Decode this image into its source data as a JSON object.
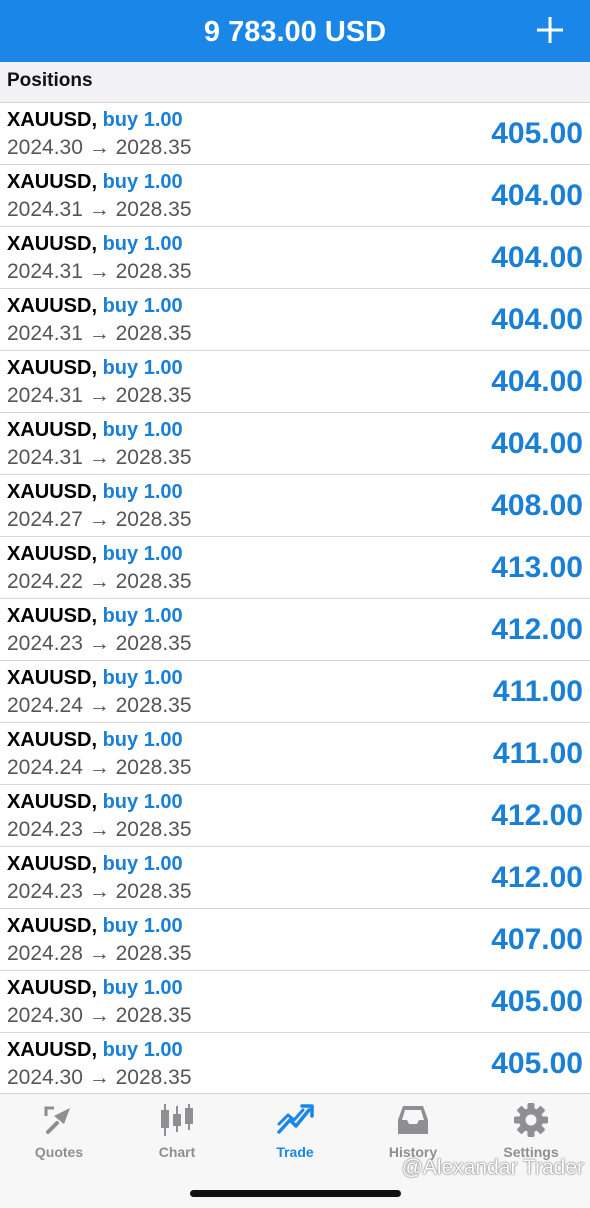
{
  "header": {
    "balance": "9 783.00 USD",
    "add_icon": "plus-icon"
  },
  "section": {
    "title": "Positions"
  },
  "positions": [
    {
      "symbol": "XAUUSD",
      "side": "buy 1.00",
      "open_price": "2024.30",
      "arrow": "→",
      "current_price": "2028.35",
      "profit": "405.00"
    },
    {
      "symbol": "XAUUSD",
      "side": "buy 1.00",
      "open_price": "2024.31",
      "arrow": "→",
      "current_price": "2028.35",
      "profit": "404.00"
    },
    {
      "symbol": "XAUUSD",
      "side": "buy 1.00",
      "open_price": "2024.31",
      "arrow": "→",
      "current_price": "2028.35",
      "profit": "404.00"
    },
    {
      "symbol": "XAUUSD",
      "side": "buy 1.00",
      "open_price": "2024.31",
      "arrow": "→",
      "current_price": "2028.35",
      "profit": "404.00"
    },
    {
      "symbol": "XAUUSD",
      "side": "buy 1.00",
      "open_price": "2024.31",
      "arrow": "→",
      "current_price": "2028.35",
      "profit": "404.00"
    },
    {
      "symbol": "XAUUSD",
      "side": "buy 1.00",
      "open_price": "2024.31",
      "arrow": "→",
      "current_price": "2028.35",
      "profit": "404.00"
    },
    {
      "symbol": "XAUUSD",
      "side": "buy 1.00",
      "open_price": "2024.27",
      "arrow": "→",
      "current_price": "2028.35",
      "profit": "408.00"
    },
    {
      "symbol": "XAUUSD",
      "side": "buy 1.00",
      "open_price": "2024.22",
      "arrow": "→",
      "current_price": "2028.35",
      "profit": "413.00"
    },
    {
      "symbol": "XAUUSD",
      "side": "buy 1.00",
      "open_price": "2024.23",
      "arrow": "→",
      "current_price": "2028.35",
      "profit": "412.00"
    },
    {
      "symbol": "XAUUSD",
      "side": "buy 1.00",
      "open_price": "2024.24",
      "arrow": "→",
      "current_price": "2028.35",
      "profit": "411.00"
    },
    {
      "symbol": "XAUUSD",
      "side": "buy 1.00",
      "open_price": "2024.24",
      "arrow": "→",
      "current_price": "2028.35",
      "profit": "411.00"
    },
    {
      "symbol": "XAUUSD",
      "side": "buy 1.00",
      "open_price": "2024.23",
      "arrow": "→",
      "current_price": "2028.35",
      "profit": "412.00"
    },
    {
      "symbol": "XAUUSD",
      "side": "buy 1.00",
      "open_price": "2024.23",
      "arrow": "→",
      "current_price": "2028.35",
      "profit": "412.00"
    },
    {
      "symbol": "XAUUSD",
      "side": "buy 1.00",
      "open_price": "2024.28",
      "arrow": "→",
      "current_price": "2028.35",
      "profit": "407.00"
    },
    {
      "symbol": "XAUUSD",
      "side": "buy 1.00",
      "open_price": "2024.30",
      "arrow": "→",
      "current_price": "2028.35",
      "profit": "405.00"
    },
    {
      "symbol": "XAUUSD",
      "side": "buy 1.00",
      "open_price": "2024.30",
      "arrow": "→",
      "current_price": "2028.35",
      "profit": "405.00"
    }
  ],
  "tabbar": {
    "tabs": [
      {
        "label": "Quotes",
        "icon": "quotes-icon",
        "active": false
      },
      {
        "label": "Chart",
        "icon": "candlestick-chart-icon",
        "active": false
      },
      {
        "label": "Trade",
        "icon": "trade-trend-icon",
        "active": true
      },
      {
        "label": "History",
        "icon": "history-inbox-icon",
        "active": false
      },
      {
        "label": "Settings",
        "icon": "gear-icon",
        "active": false
      }
    ]
  },
  "watermark": "@Alexandar Trader",
  "colors": {
    "header_bg": "#1a86e8",
    "accent": "#1a7fd6",
    "tab_inactive": "#8e8e93"
  }
}
